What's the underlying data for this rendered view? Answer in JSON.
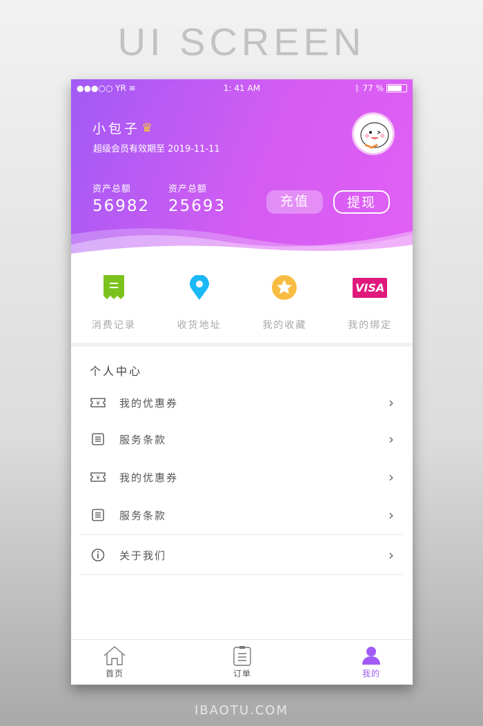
{
  "banner": {
    "title": "UI SCREEN",
    "footer": "IBAOTU.COM"
  },
  "status": {
    "carrier": "●●●○○ YR",
    "time": "1: 41 AM",
    "battery": "77 %",
    "battery_level": 0.77
  },
  "profile": {
    "name": "小包子",
    "vip_text": "超级会员有效期至 2019-11-11"
  },
  "assets": [
    {
      "label": "资产总额",
      "value": "56982"
    },
    {
      "label": "资产总额",
      "value": "25693"
    }
  ],
  "buttons": {
    "recharge": "充值",
    "withdraw": "提现"
  },
  "quick": [
    {
      "label": "消费记录",
      "icon": "receipt-icon",
      "color": "#7cc21e"
    },
    {
      "label": "收货地址",
      "icon": "location-pin-icon",
      "color": "#1ab8f7"
    },
    {
      "label": "我的收藏",
      "icon": "star-icon",
      "color": "#f8bc43"
    },
    {
      "label": "我的绑定",
      "icon": "visa-card-icon",
      "color": "#e0197d",
      "badge": "VISA"
    }
  ],
  "section_title": "个人中心",
  "menu": [
    {
      "label": "我的优惠券",
      "icon": "coupon-icon"
    },
    {
      "label": "服务条款",
      "icon": "document-icon"
    },
    {
      "label": "我的优惠券",
      "icon": "coupon-icon"
    },
    {
      "label": "服务条款",
      "icon": "document-icon"
    },
    {
      "label": "关于我们",
      "icon": "info-icon"
    }
  ],
  "tabs": [
    {
      "label": "首页"
    },
    {
      "label": "订单"
    },
    {
      "label": "我的",
      "active": true
    }
  ],
  "colors": {
    "accent": "#a15bf5",
    "header_start": "#a25af4",
    "header_end": "#e160f4"
  }
}
